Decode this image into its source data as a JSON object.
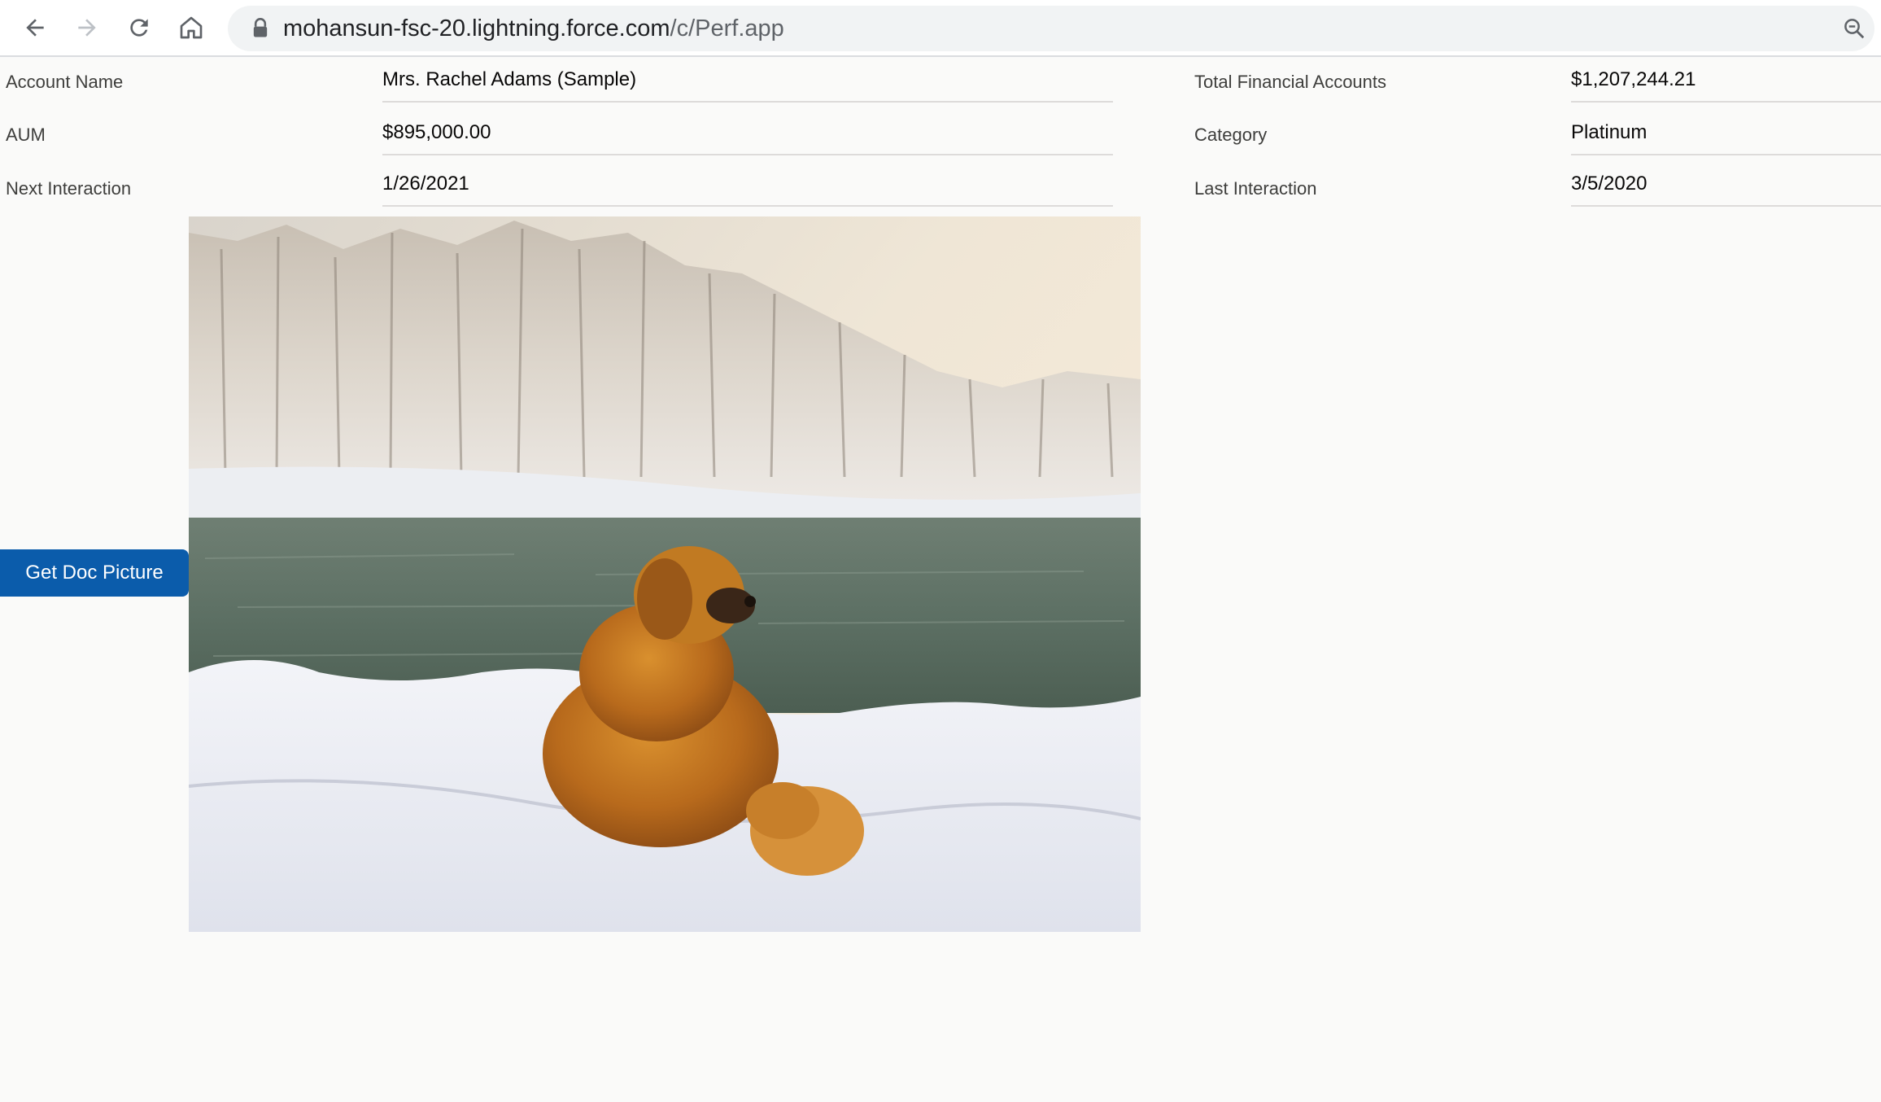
{
  "browser": {
    "url_host": "mohansun-fsc-20.lightning.force.com",
    "url_path": "/c/Perf.app",
    "icons": [
      "back-arrow-icon",
      "forward-arrow-icon",
      "reload-icon",
      "home-icon",
      "lock-icon",
      "zoom-icon"
    ]
  },
  "fields": {
    "account_name": {
      "label": "Account Name",
      "value": "Mrs. Rachel Adams (Sample)"
    },
    "aum": {
      "label": "AUM",
      "value": "$895,000.00"
    },
    "next_interaction": {
      "label": "Next Interaction",
      "value": "1/26/2021"
    },
    "total_financial_accounts": {
      "label": "Total Financial Accounts",
      "value": "$1,207,244.21"
    },
    "category": {
      "label": "Category",
      "value": "Platinum"
    },
    "last_interaction": {
      "label": "Last Interaction",
      "value": "3/5/2020"
    }
  },
  "actions": {
    "get_doc_picture_label": "Get Doc Picture"
  },
  "colors": {
    "button_bg": "#0b5cab",
    "page_bg": "#fafaf9"
  }
}
